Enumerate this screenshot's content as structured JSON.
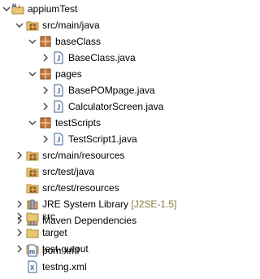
{
  "tree": {
    "project": {
      "label": "appiumTest",
      "icon": "maven-project-icon"
    },
    "src_main_java": {
      "label": "src/main/java",
      "icon": "source-folder-icon"
    },
    "pkg_baseClass": {
      "label": "baseClass",
      "icon": "package-icon"
    },
    "file_BaseClass": {
      "label": "BaseClass.java",
      "icon": "java-file-icon"
    },
    "pkg_pages": {
      "label": "pages",
      "icon": "package-icon"
    },
    "file_BasePOMpage": {
      "label": "BasePOMpage.java",
      "icon": "java-file-icon"
    },
    "file_CalculatorScreen": {
      "label": "CalculatorScreen.java",
      "icon": "java-file-icon"
    },
    "pkg_testScripts": {
      "label": "testScripts",
      "icon": "package-icon"
    },
    "file_TestScript1": {
      "label": "TestScript1.java",
      "icon": "java-file-icon"
    },
    "src_main_resources": {
      "label": "src/main/resources",
      "icon": "source-folder-icon"
    },
    "src_test_java": {
      "label": "src/test/java",
      "icon": "source-folder-icon"
    },
    "src_test_resources": {
      "label": "src/test/resources",
      "icon": "source-folder-icon"
    },
    "jre_library": {
      "label": "JRE System Library",
      "decoration": "[J2SE-1.5]",
      "icon": "library-icon"
    },
    "maven_deps": {
      "label": "Maven Dependencies",
      "icon": "library-icon"
    },
    "folder_src": {
      "label": "src",
      "icon": "folder-icon"
    },
    "folder_target": {
      "label": "target",
      "icon": "folder-icon"
    },
    "folder_test_output": {
      "label": "test-output",
      "icon": "folder-icon"
    },
    "file_pom": {
      "label": "pom.xml",
      "icon": "maven-pom-icon"
    },
    "file_testng": {
      "label": "testng.xml",
      "icon": "xml-file-icon"
    }
  },
  "colors": {
    "decoration": "#8b7a3a",
    "folder": "#e8c770",
    "package": "#b5651d",
    "java": "#3b5ea8"
  }
}
